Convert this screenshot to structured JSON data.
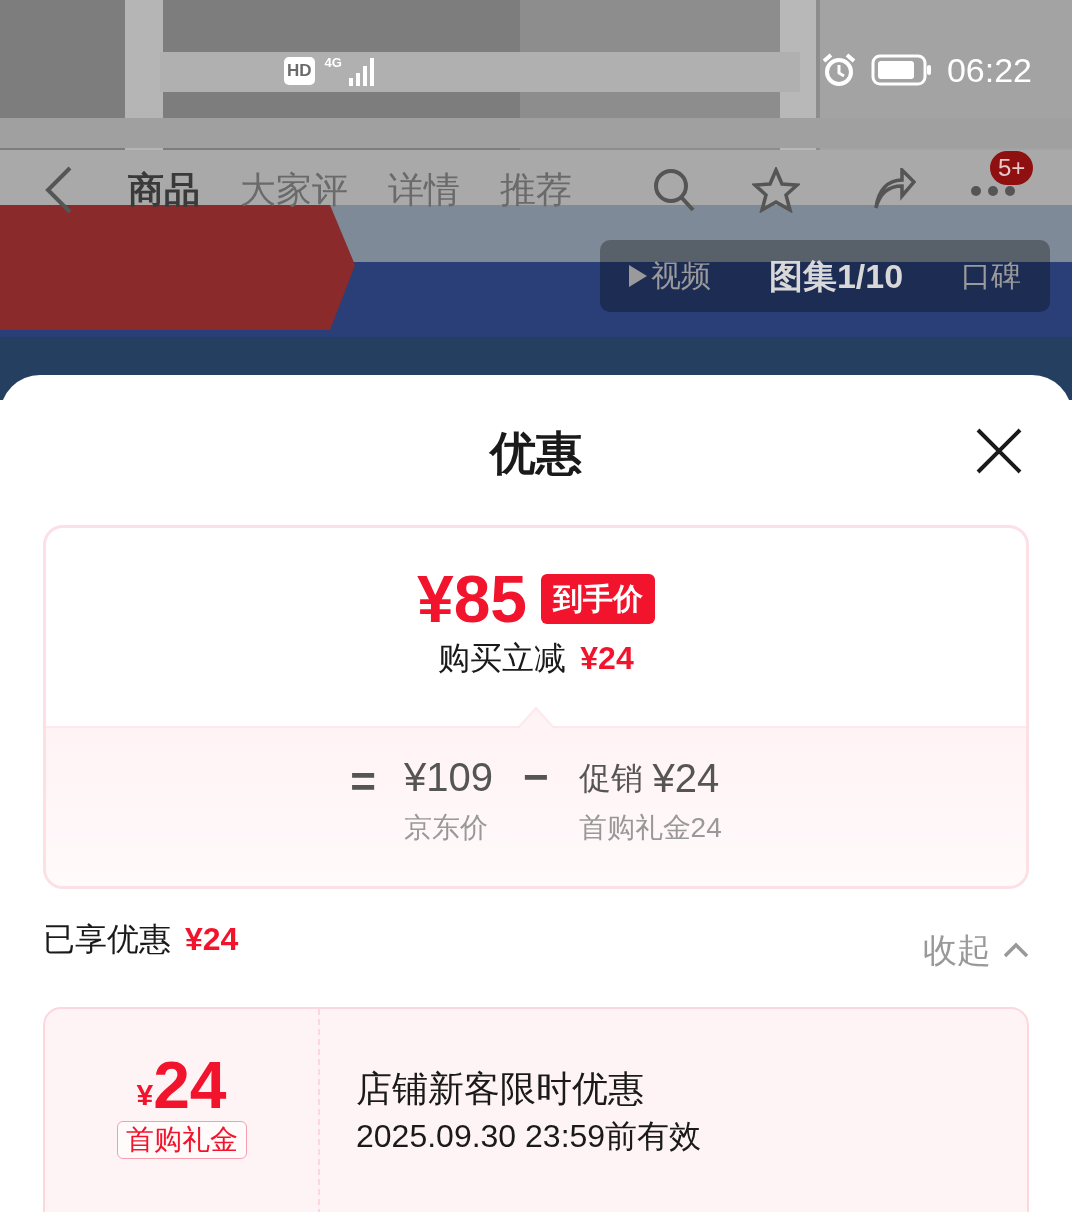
{
  "status_bar": {
    "hd_label": "HD",
    "network": "4G",
    "time": "06:22"
  },
  "nav_tabs": [
    {
      "label": "商品",
      "selected": true
    },
    {
      "label": "大家评",
      "selected": false
    },
    {
      "label": "详情",
      "selected": false
    },
    {
      "label": "推荐",
      "selected": false
    }
  ],
  "cart_badge": "5+",
  "media_tabs": [
    {
      "label": "视频",
      "selected": false,
      "kind": "video"
    },
    {
      "label": "图集1/10",
      "selected": true,
      "kind": "text"
    },
    {
      "label": "口碑",
      "selected": false,
      "kind": "text"
    }
  ],
  "sheet": {
    "title": "优惠"
  },
  "price_card": {
    "final_price": "¥85",
    "final_tag": "到手价",
    "saving_label": "购买立减",
    "saving_amount": "¥24",
    "equals": "=",
    "base_price": "¥109",
    "base_label": "京东价",
    "minus": "−",
    "promo_label": "促销",
    "promo_amount": "¥24",
    "promo_detail": "首购礼金24"
  },
  "enjoyed": {
    "label": "已享优惠",
    "amount": "¥24",
    "toggle": "收起"
  },
  "coupons": [
    {
      "currency": "¥",
      "amount": "24",
      "tag": "首购礼金",
      "title": "店铺新客限时优惠",
      "validity": "2025.09.30 23:59前有效"
    }
  ]
}
